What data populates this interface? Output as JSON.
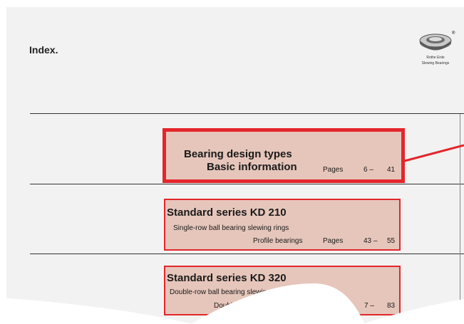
{
  "header": {
    "title": "Index."
  },
  "logo": {
    "caption_line1": "Rothe Erde",
    "caption_line2": "Slewing Bearings",
    "reg_mark": "®"
  },
  "sections": [
    {
      "title_line1": "Bearing design types",
      "title_line2": "Basic information",
      "pages_label": "Pages",
      "page_from": "6 –",
      "page_to": "41"
    },
    {
      "title": "Standard series KD 210",
      "subtitle": "Single-row ball bearing slewing rings",
      "profile_label": "Profile bearings",
      "pages_label": "Pages",
      "page_from": "43 –",
      "page_to": "55"
    },
    {
      "title": "Standard series KD 320",
      "subtitle": "Double-row ball bearing slewing r",
      "profile_label": "Double",
      "page_from": "7 –",
      "page_to": "83"
    }
  ],
  "colors": {
    "highlight_border": "#e3262b",
    "highlight_fill": "#e6c6bb",
    "page_bg": "#f2f2f2"
  }
}
